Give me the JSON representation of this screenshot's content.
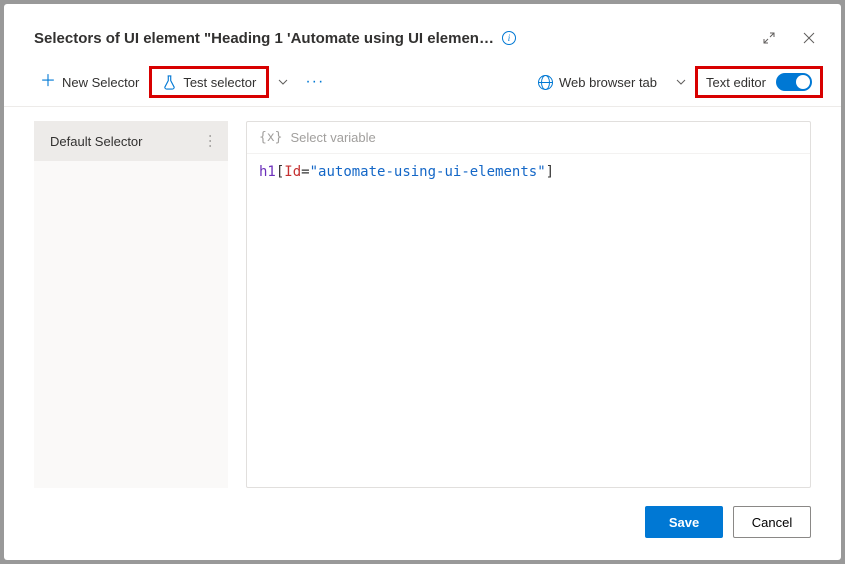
{
  "header": {
    "title": "Selectors of UI element \"Heading 1 'Automate using UI elemen…"
  },
  "toolbar": {
    "new_selector_label": "New Selector",
    "test_selector_label": "Test selector",
    "web_browser_tab_label": "Web browser tab",
    "text_editor_label": "Text editor",
    "text_editor_on": true
  },
  "sidebar": {
    "items": [
      {
        "label": "Default Selector"
      }
    ]
  },
  "editor": {
    "select_variable_placeholder": "Select variable",
    "selector": {
      "tag": "h1",
      "attr": "Id",
      "value": "automate-using-ui-elements"
    }
  },
  "footer": {
    "save_label": "Save",
    "cancel_label": "Cancel"
  }
}
